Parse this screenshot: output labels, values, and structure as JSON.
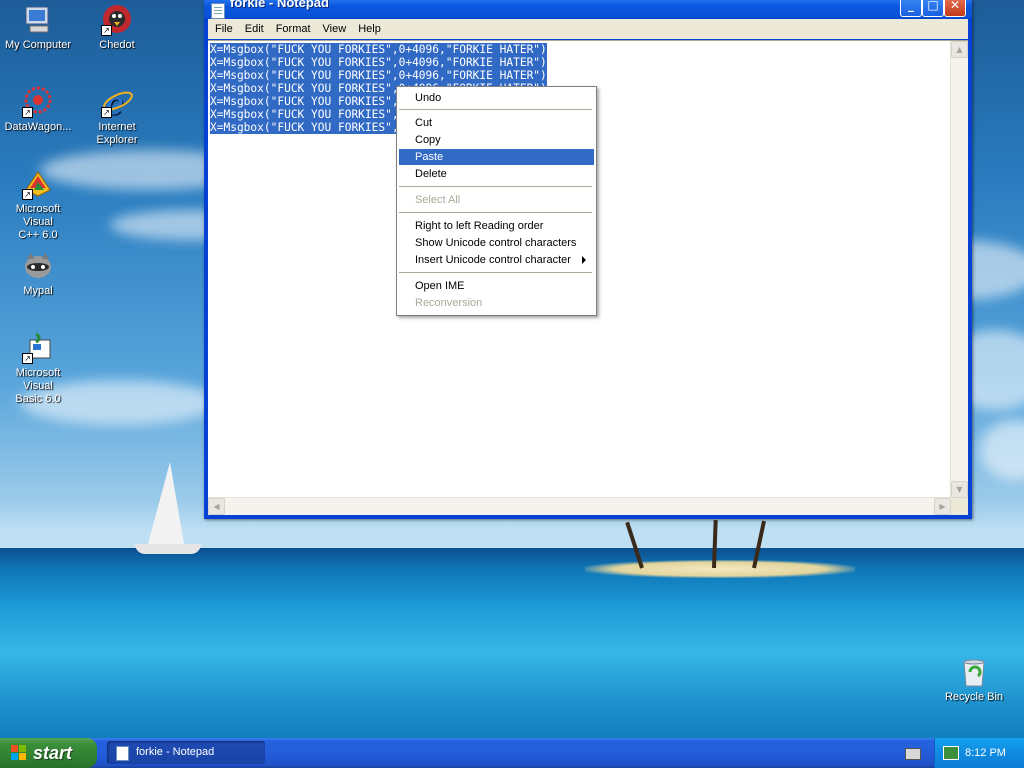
{
  "desktop": {
    "icons": [
      {
        "label": "My Computer"
      },
      {
        "label": "Chedot"
      },
      {
        "label": "DataWagon..."
      },
      {
        "label_line1": "Internet",
        "label_line2": "Explorer"
      },
      {
        "label_line1": "Microsoft Visual",
        "label_line2": "C++ 6.0"
      },
      {
        "label": "Mypal"
      },
      {
        "label_line1": "Microsoft Visual",
        "label_line2": "Basic 6.0"
      },
      {
        "label": "Recycle Bin"
      }
    ]
  },
  "window": {
    "title": "forkie - Notepad",
    "buttons": {
      "minimize": "_",
      "maximize": "□",
      "close": "✕"
    },
    "menu": [
      "File",
      "Edit",
      "Format",
      "View",
      "Help"
    ],
    "lines": [
      "X=Msgbox(\"FUCK YOU FORKIES\",0+4096,\"FORKIE HATER\")",
      "X=Msgbox(\"FUCK YOU FORKIES\",0+4096,\"FORKIE HATER\")",
      "X=Msgbox(\"FUCK YOU FORKIES\",0+4096,\"FORKIE HATER\")",
      "X=Msgbox(\"FUCK YOU FORKIES\",0+4096,\"FORKIE HATER\")",
      "X=Msgbox(\"FUCK YOU FORKIES\",0+4096,\"FORKIE HATER\")",
      "X=Msgbox(\"FUCK YOU FORKIES\",0+4096,\"FORKIE HATER\")",
      "X=Msgbox(\"FUCK YOU FORKIES\",0+4096,\"FORKIE HATER\")"
    ]
  },
  "context_menu": {
    "undo": "Undo",
    "cut": "Cut",
    "copy": "Copy",
    "paste": "Paste",
    "delete": "Delete",
    "select_all": "Select All",
    "rtl": "Right to left Reading order",
    "show_unicode": "Show Unicode control characters",
    "insert_unicode": "Insert Unicode control character",
    "open_ime": "Open IME",
    "reconversion": "Reconversion",
    "highlighted": "Paste"
  },
  "taskbar": {
    "start_label": "start",
    "task_button": "forkie - Notepad",
    "clock": "8:12 PM"
  },
  "colors": {
    "selection": "#316ac5",
    "title_bar": "#0a58e0",
    "start_button": "#3c8f3c"
  }
}
